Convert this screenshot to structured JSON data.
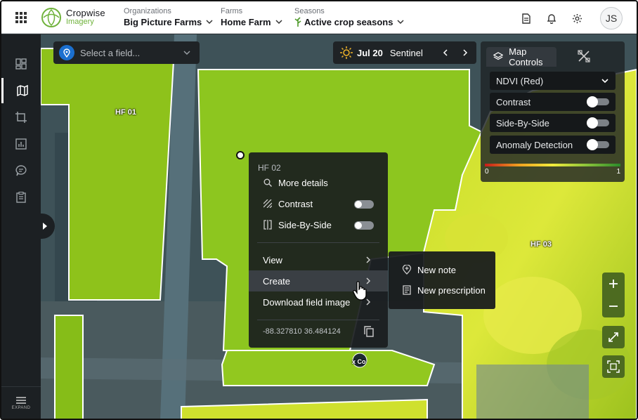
{
  "app": {
    "brand_line1": "Cropwise",
    "brand_line2": "Imagery"
  },
  "topbar": {
    "organizations": {
      "label": "Organizations",
      "value": "Big Picture Farms"
    },
    "farms": {
      "label": "Farms",
      "value": "Home Farm"
    },
    "seasons": {
      "label": "Seasons",
      "value": "Active crop seasons"
    },
    "avatar_initials": "JS",
    "icons": [
      "apps-grid-icon",
      "document-icon",
      "bell-icon",
      "gear-icon"
    ]
  },
  "sidebar": {
    "items": [
      "dashboard-icon",
      "map-icon",
      "crop-icon",
      "reports-icon",
      "notes-icon",
      "clipboard-icon"
    ],
    "active_index": 1,
    "expand_label": "EXPAND"
  },
  "field_select": {
    "placeholder": "Select a field..."
  },
  "date_bar": {
    "date": "Jul 20",
    "source": "Sentinel"
  },
  "map_controls": {
    "tab_label": "Map Controls",
    "layer": "NDVI (Red)",
    "toggles": [
      {
        "label": "Contrast",
        "on": false
      },
      {
        "label": "Side-By-Side",
        "on": false
      },
      {
        "label": "Anomaly Detection",
        "on": false
      }
    ],
    "scale_min": "0",
    "scale_max": "1",
    "scale_colors": [
      "#c61b1b",
      "#f0a020",
      "#f2ec3c",
      "#8cc43a",
      "#2a8a2a"
    ]
  },
  "fields": {
    "hf01": "HF 01",
    "hf03": "HF 03",
    "small": "x Co"
  },
  "context_menu": {
    "title": "HF 02",
    "more_details": "More details",
    "contrast": "Contrast",
    "side_by_side": "Side-By-Side",
    "view": "View",
    "create": "Create",
    "download": "Download field image",
    "coords": "-88.327810 36.484124"
  },
  "submenu": {
    "new_note": "New note",
    "new_prescription": "New prescription"
  },
  "colors": {
    "accent_green": "#6fb23b",
    "map_button": "#4d6b20"
  }
}
